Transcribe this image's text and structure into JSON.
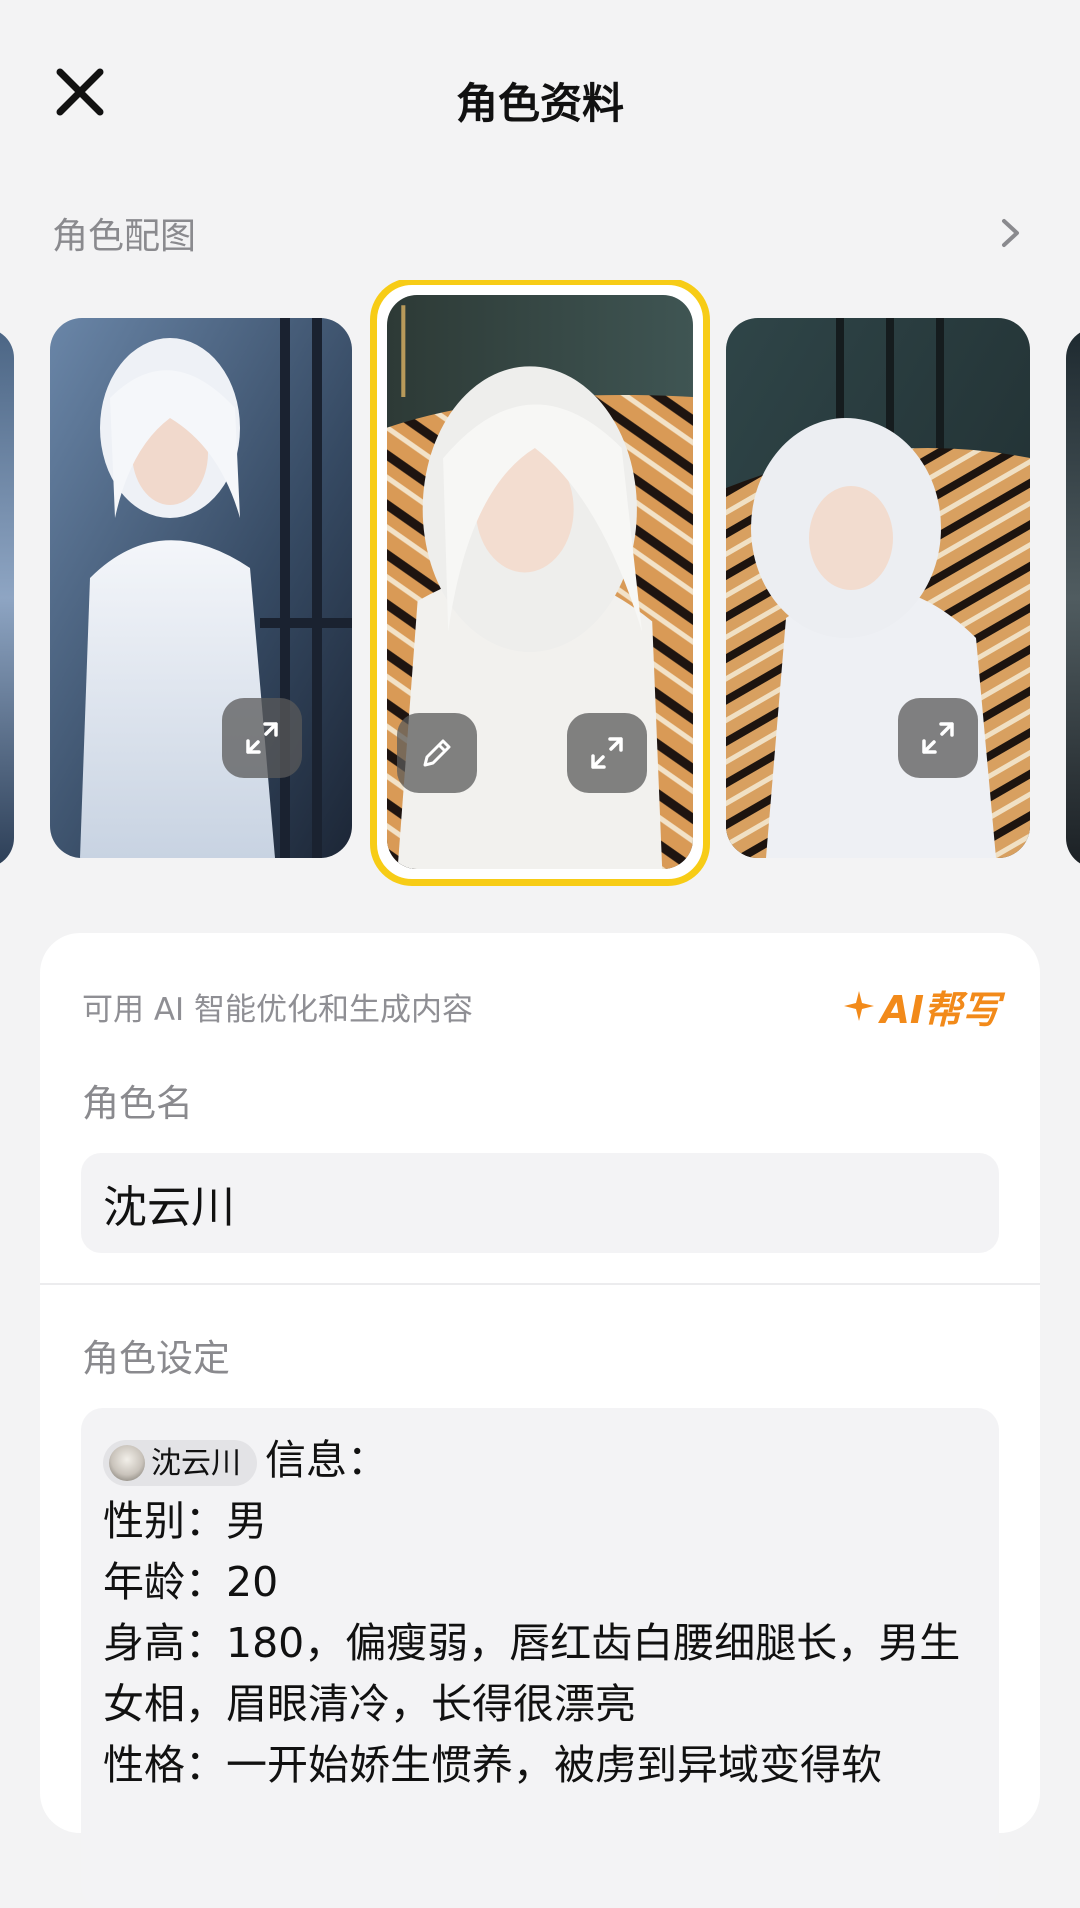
{
  "header": {
    "title": "角色资料"
  },
  "section": {
    "label": "角色配图"
  },
  "gallery": {
    "selected_index": 1
  },
  "form": {
    "ai_hint": "可用 AI 智能优化和生成内容",
    "ai_button": "AI帮写",
    "name_label": "角色名",
    "name_value": "沈云川",
    "setting_label": "角色设定",
    "setting": {
      "mention": "沈云川",
      "info_suffix": "信息：",
      "lines": [
        "性别：男",
        "年龄：20",
        "身高：180，偏瘦弱，唇红齿白腰细腿长，男生女相，眉眼清冷，长得很漂亮",
        "性格：一开始娇生惯养，被虏到异域变得软"
      ]
    }
  },
  "colors": {
    "accent": "#f7cc16",
    "ai": "#f28a1a",
    "background": "#f3f3f4"
  }
}
